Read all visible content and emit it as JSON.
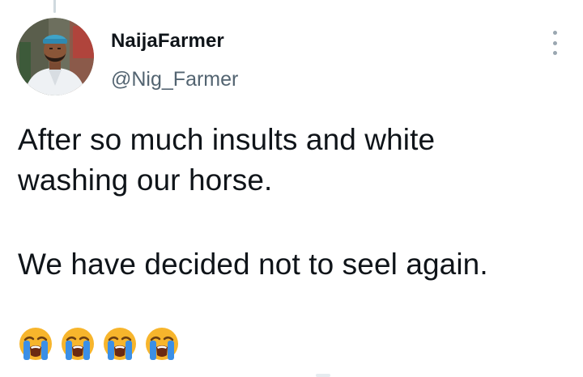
{
  "user": {
    "display_name": "NaijaFarmer",
    "handle": "@Nig_Farmer"
  },
  "menu": {
    "icon": "more-vertical-icon"
  },
  "tweet": {
    "line1": "After so much insults and white",
    "line2": "washing our horse.",
    "line3": "We have decided not to seel again.",
    "emojis": [
      "loudly-crying-face",
      "loudly-crying-face",
      "loudly-crying-face",
      "loudly-crying-face"
    ]
  },
  "colors": {
    "text": "#0f1419",
    "secondary_text": "#536471",
    "emoji_face": "#f7b52c",
    "emoji_tears": "#3b8fe6"
  }
}
